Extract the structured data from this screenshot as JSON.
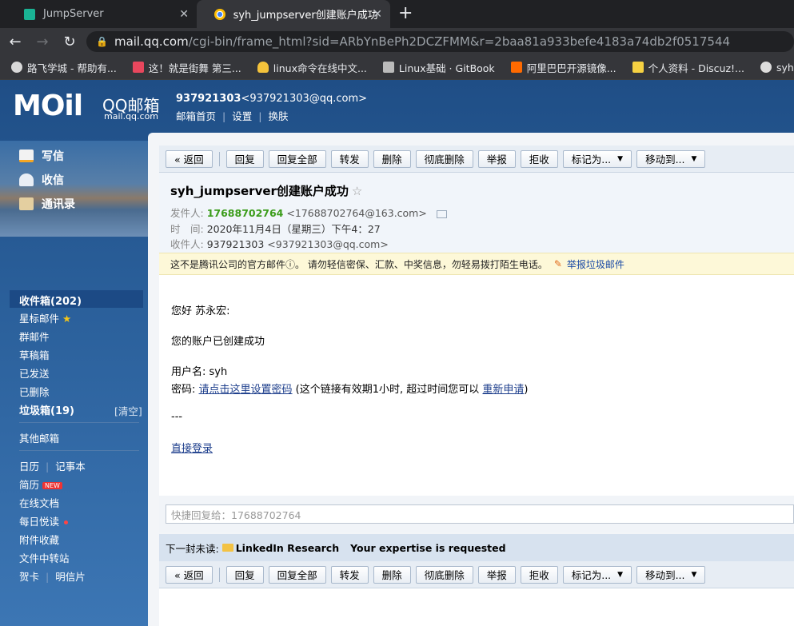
{
  "browser": {
    "tabs": [
      {
        "title": "JumpServer"
      },
      {
        "title": "syh_jumpserver创建账户成功 - "
      }
    ],
    "tab_close": "✕",
    "new_tab": "+",
    "url_host": "mail.qq.com",
    "url_path": "/cgi-bin/frame_html?sid=ARbYnBePh2DCZFMM&r=2baa81a933befe4183a74db2f0517544",
    "bookmarks": [
      {
        "label": "路飞学城 - 帮助有...",
        "color": "#d9d9d9"
      },
      {
        "label": "这！就是街舞 第三...",
        "color": "#e8475d"
      },
      {
        "label": "linux命令在线中文...",
        "color": "#f5c33b"
      },
      {
        "label": "Linux基础 · GitBook",
        "color": "#bbbbbb"
      },
      {
        "label": "阿里巴巴开源镜像...",
        "color": "#ff6a00"
      },
      {
        "label": "个人资料 - Discuz!...",
        "color": "#f5d142"
      },
      {
        "label": "syh - ...",
        "color": "#dddddd"
      }
    ]
  },
  "header": {
    "logo_mo": "MOil",
    "logo_qq": "QQ邮箱",
    "logo_url": "mail.qq.com",
    "user_number": "937921303",
    "user_email": "<937921303@qq.com>",
    "links": [
      "邮箱首页",
      "设置",
      "换肤"
    ]
  },
  "sidebar": {
    "write": "写信",
    "receive": "收信",
    "contacts": "通讯录",
    "inbox": "收件箱(202)",
    "starred": "星标邮件",
    "star_glyph": "★",
    "group": "群邮件",
    "drafts": "草稿箱",
    "sent": "已发送",
    "deleted": "已删除",
    "spam": "垃圾箱(19)",
    "spam_clear": "[清空]",
    "other": "其他邮箱",
    "calendar": "日历",
    "notebook": "记事本",
    "resume": "简历",
    "new_badge": "NEW",
    "docs": "在线文档",
    "daily": "每日悦读",
    "attachments": "附件收藏",
    "transfer": "文件中转站",
    "card": "贺卡",
    "postcard": "明信片"
  },
  "toolbar": {
    "back": "« 返回",
    "reply": "回复",
    "reply_all": "回复全部",
    "forward": "转发",
    "delete": "删除",
    "delete_perm": "彻底删除",
    "report": "举报",
    "reject": "拒收",
    "mark_as": "标记为...",
    "move_to": "移动到...",
    "caret": "▼"
  },
  "mail": {
    "subject": "syh_jumpserver创建账户成功",
    "star": "☆",
    "from_label": "发件人:",
    "from_name": "17688702764",
    "from_addr": "<17688702764@163.com>",
    "time_label": "时　间:",
    "time_value": "2020年11月4日（星期三）下午4：27",
    "to_label": "收件人:",
    "to_name": "937921303",
    "to_addr": "<937921303@qq.com>",
    "warning": "这不是腾讯公司的官方邮件ⓘ。 请勿轻信密保、汇款、中奖信息，勿轻易拨打陌生电话。",
    "warning_link": "举报垃圾邮件",
    "greeting": "您好 苏永宏:",
    "created": "您的账户已创建成功",
    "username_line": "用户名: syh",
    "password_label": "密码: ",
    "password_link": "请点击这里设置密码",
    "password_note": " (这个链接有效期1小时, 超过时间您可以 ",
    "reapply_link": "重新申请",
    "close_paren": ")",
    "dashes": "---",
    "login_link": "直接登录"
  },
  "quick_reply": {
    "placeholder": "快捷回复给：17688702764"
  },
  "next_unread": {
    "label": "下一封未读:",
    "sender": "LinkedIn Research",
    "subject": "Your expertise is requested"
  }
}
